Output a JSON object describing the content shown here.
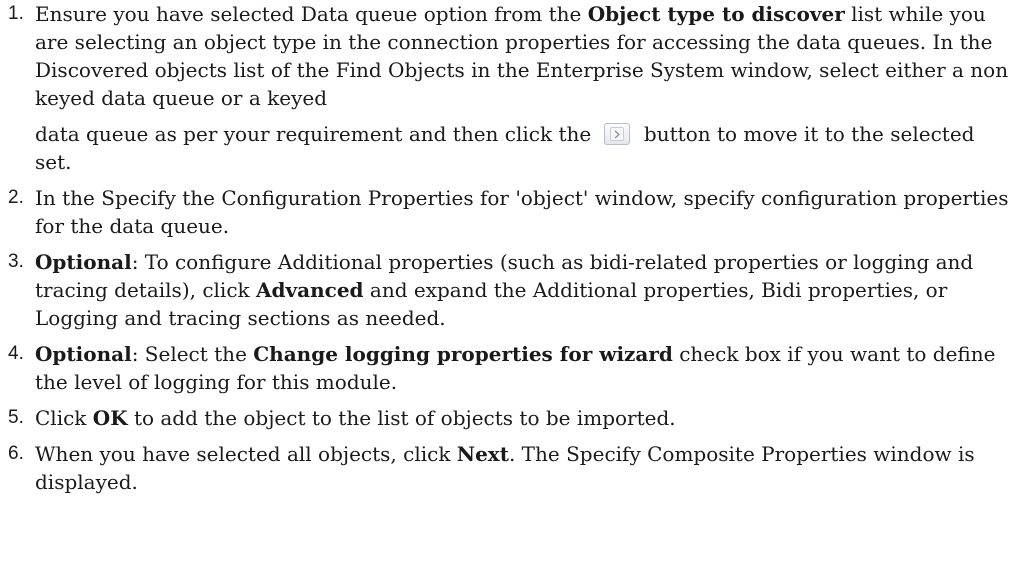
{
  "steps": [
    {
      "number": "1.",
      "t1": "Ensure you have selected Data queue option from the ",
      "b1": "Object type to discover",
      "t2": " list while you are selecting an object type in the connection properties for accessing the data queues. In the Discovered objects list of the Find Objects in the Enterprise System window, select either a non keyed data queue or a keyed",
      "t3": "data queue as per your requirement and then click the ",
      "t4": " button to move it to the selected set.",
      "button_icon": "move-right-arrow-icon"
    },
    {
      "number": "2.",
      "t1": " In the Specify the Configuration Properties for 'object' window, specify configuration properties for the data queue."
    },
    {
      "number": "3.",
      "b1": "Optional",
      "t1": ": To configure Additional properties (such as bidi-related properties or logging and tracing details), click ",
      "b2": "Advanced",
      "t2": " and expand the Additional properties, Bidi properties, or Logging and tracing sections as needed."
    },
    {
      "number": "4.",
      "b1": "Optional",
      "t1": ": Select the ",
      "b2": "Change logging properties for wizard",
      "t2": " check box if you want to define the level of logging for this module."
    },
    {
      "number": "5.",
      "t1": "Click ",
      "b1": "OK",
      "t2": " to add the object to the list of objects to be imported."
    },
    {
      "number": "6.",
      "t1": "When you have selected all objects, click ",
      "b1": "Next",
      "t2": ". The Specify Composite Properties window is displayed."
    }
  ]
}
